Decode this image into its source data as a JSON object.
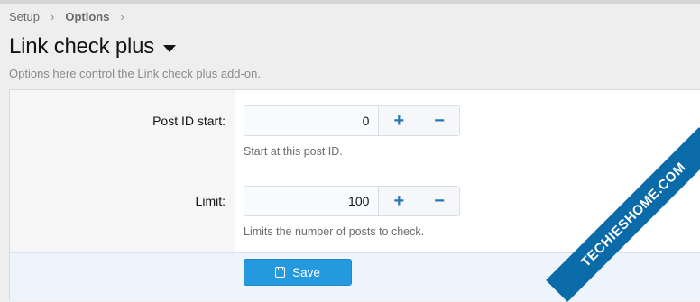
{
  "breadcrumb": {
    "items": [
      "Setup",
      "Options"
    ],
    "separator": "›"
  },
  "page": {
    "title": "Link check plus",
    "description": "Options here control the Link check plus add-on."
  },
  "fields": [
    {
      "label": "Post ID start:",
      "value": "0",
      "increment": "+",
      "decrement": "−",
      "hint": "Start at this post ID."
    },
    {
      "label": "Limit:",
      "value": "100",
      "increment": "+",
      "decrement": "−",
      "hint": "Limits the number of posts to check."
    }
  ],
  "footer": {
    "save_label": "Save",
    "save_icon": "save-disk-icon"
  },
  "watermark": {
    "text": "TECHIESHOME.COM"
  },
  "colors": {
    "accent": "#2599e0",
    "stepper_icon": "#2577b1",
    "footer_bg": "#edf4fb"
  }
}
